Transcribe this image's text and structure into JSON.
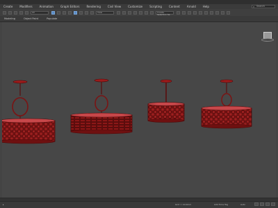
{
  "menu": {
    "items": [
      "Create",
      "Modifiers",
      "Animation",
      "Graph Editors",
      "Rendering",
      "Civil View",
      "Customize",
      "Scripting",
      "Content",
      "Arnold",
      "Help"
    ]
  },
  "search": {
    "placeholder": "Search"
  },
  "toolbar": {
    "selection_set": "Create Selection Se"
  },
  "ribbon": {
    "tabs": [
      "Modeling",
      "Object Paint",
      "Populate"
    ]
  },
  "status": {
    "coords": "Grid = 10.0mm",
    "add_time_tag": "Add Time Tag",
    "auto_key": "Auto"
  },
  "colors": {
    "lamp": "#9b1c1c",
    "lamp_dark": "#5a0d0d",
    "lamp_light": "#c7474a"
  },
  "lamps": [
    {
      "style": "round-drum"
    },
    {
      "style": "wide-drum"
    },
    {
      "style": "short-drum"
    },
    {
      "style": "round-drum-2"
    }
  ]
}
